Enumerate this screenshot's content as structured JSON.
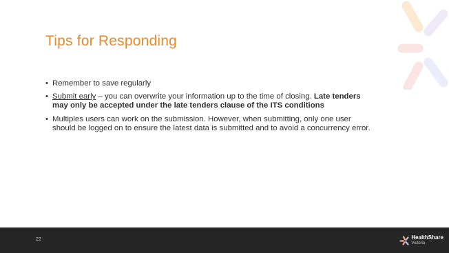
{
  "slide": {
    "title": "Tips for Responding",
    "page_number": "22",
    "bullets": [
      {
        "parts": [
          {
            "text": "Remember to save regularly",
            "style": "normal"
          }
        ]
      },
      {
        "parts": [
          {
            "text": "Submit early",
            "style": "underline"
          },
          {
            "text": " – you can overwrite your information up to the time of closing. ",
            "style": "normal"
          },
          {
            "text": "Late tenders may only be accepted under the late tenders clause of the ITS conditions",
            "style": "bold"
          }
        ]
      },
      {
        "parts": [
          {
            "text": "Multiples users can work on the submission. However, when submitting, only one user should be logged on to ensure the latest data is submitted and to avoid a concurrency error.",
            "style": "normal"
          }
        ]
      }
    ]
  },
  "brand": {
    "name": "HealthShare",
    "sub": "Victoria",
    "icon": "healthshare-logo-icon",
    "colors": {
      "title": "#e8892b",
      "footer": "#262626",
      "deco_orange": "#f6b25c",
      "deco_pink": "#f3a6a0",
      "deco_purple": "#c9b4e8",
      "deco_lavender": "#b8c4ef"
    }
  }
}
